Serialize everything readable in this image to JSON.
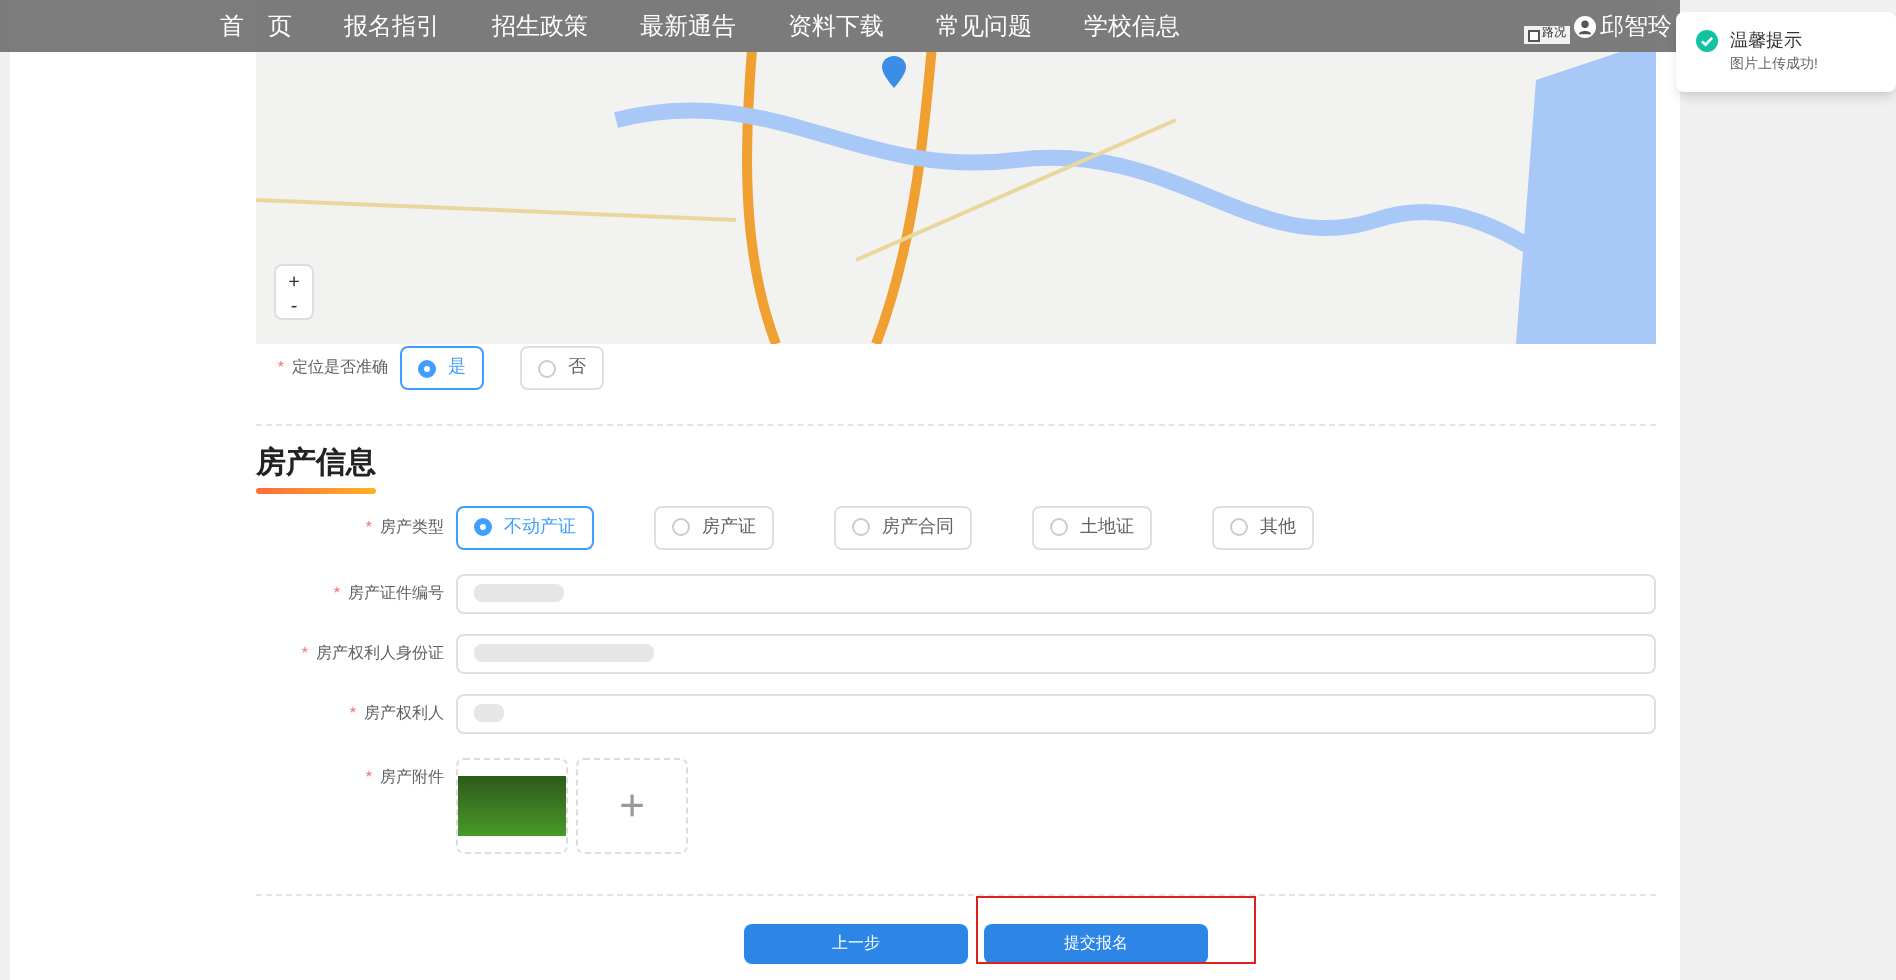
{
  "nav": {
    "items": [
      {
        "label": "首　页",
        "selected": false
      },
      {
        "label": "报名指引",
        "selected": false
      },
      {
        "label": "招生政策",
        "selected": false
      },
      {
        "label": "最新通告",
        "selected": false
      },
      {
        "label": "资料下载",
        "selected": false
      },
      {
        "label": "常见问题",
        "selected": false
      },
      {
        "label": "学校信息",
        "selected": false
      }
    ],
    "user": "邱智玲"
  },
  "map": {
    "layers": [
      {
        "label": "路况",
        "checked": false
      }
    ],
    "zoom_in": "+",
    "zoom_out": "-"
  },
  "toast": {
    "title": "温馨提示",
    "message": "图片上传成功!"
  },
  "location_check": {
    "label": "定位是否准确",
    "required_mark": "*",
    "options": [
      {
        "label": "是",
        "selected": true
      },
      {
        "label": "否",
        "selected": false
      }
    ]
  },
  "section": {
    "title": "房产信息"
  },
  "property_type": {
    "label": "房产类型",
    "required_mark": "*",
    "options": [
      {
        "label": "不动产证",
        "selected": true
      },
      {
        "label": "房产证",
        "selected": false
      },
      {
        "label": "房产合同",
        "selected": false
      },
      {
        "label": "土地证",
        "selected": false
      },
      {
        "label": "其他",
        "selected": false
      }
    ]
  },
  "fields": [
    {
      "label": "房产证件编号",
      "required_mark": "*"
    },
    {
      "label": "房产权利人身份证",
      "required_mark": "*"
    },
    {
      "label": "房产权利人",
      "required_mark": "*"
    }
  ],
  "attachment": {
    "label": "房产附件",
    "required_mark": "*",
    "add": "+"
  },
  "buttons": [
    {
      "label": "上一步",
      "highlighted": false
    },
    {
      "label": "提交报名",
      "highlighted": true
    }
  ]
}
